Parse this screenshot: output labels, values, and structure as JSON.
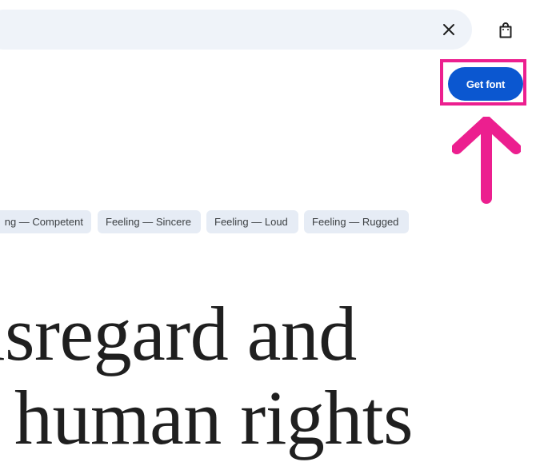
{
  "header": {
    "clear_icon": "close-icon",
    "bag_icon": "shopping-bag-icon"
  },
  "actions": {
    "get_font_label": "Get font"
  },
  "annotation": {
    "highlight_color": "#ec1f8f",
    "arrow_icon": "arrow-up-icon"
  },
  "chips": [
    {
      "label": "ng — Competent"
    },
    {
      "label": "Feeling — Sincere"
    },
    {
      "label": "Feeling — Loud"
    },
    {
      "label": "Feeling — Rugged"
    }
  ],
  "preview": {
    "line1": "isregard and",
    "line2": "human rights"
  },
  "colors": {
    "accent": "#0b57d0",
    "search_bg": "#eff3f9",
    "chip_bg": "#e6ecf5"
  }
}
